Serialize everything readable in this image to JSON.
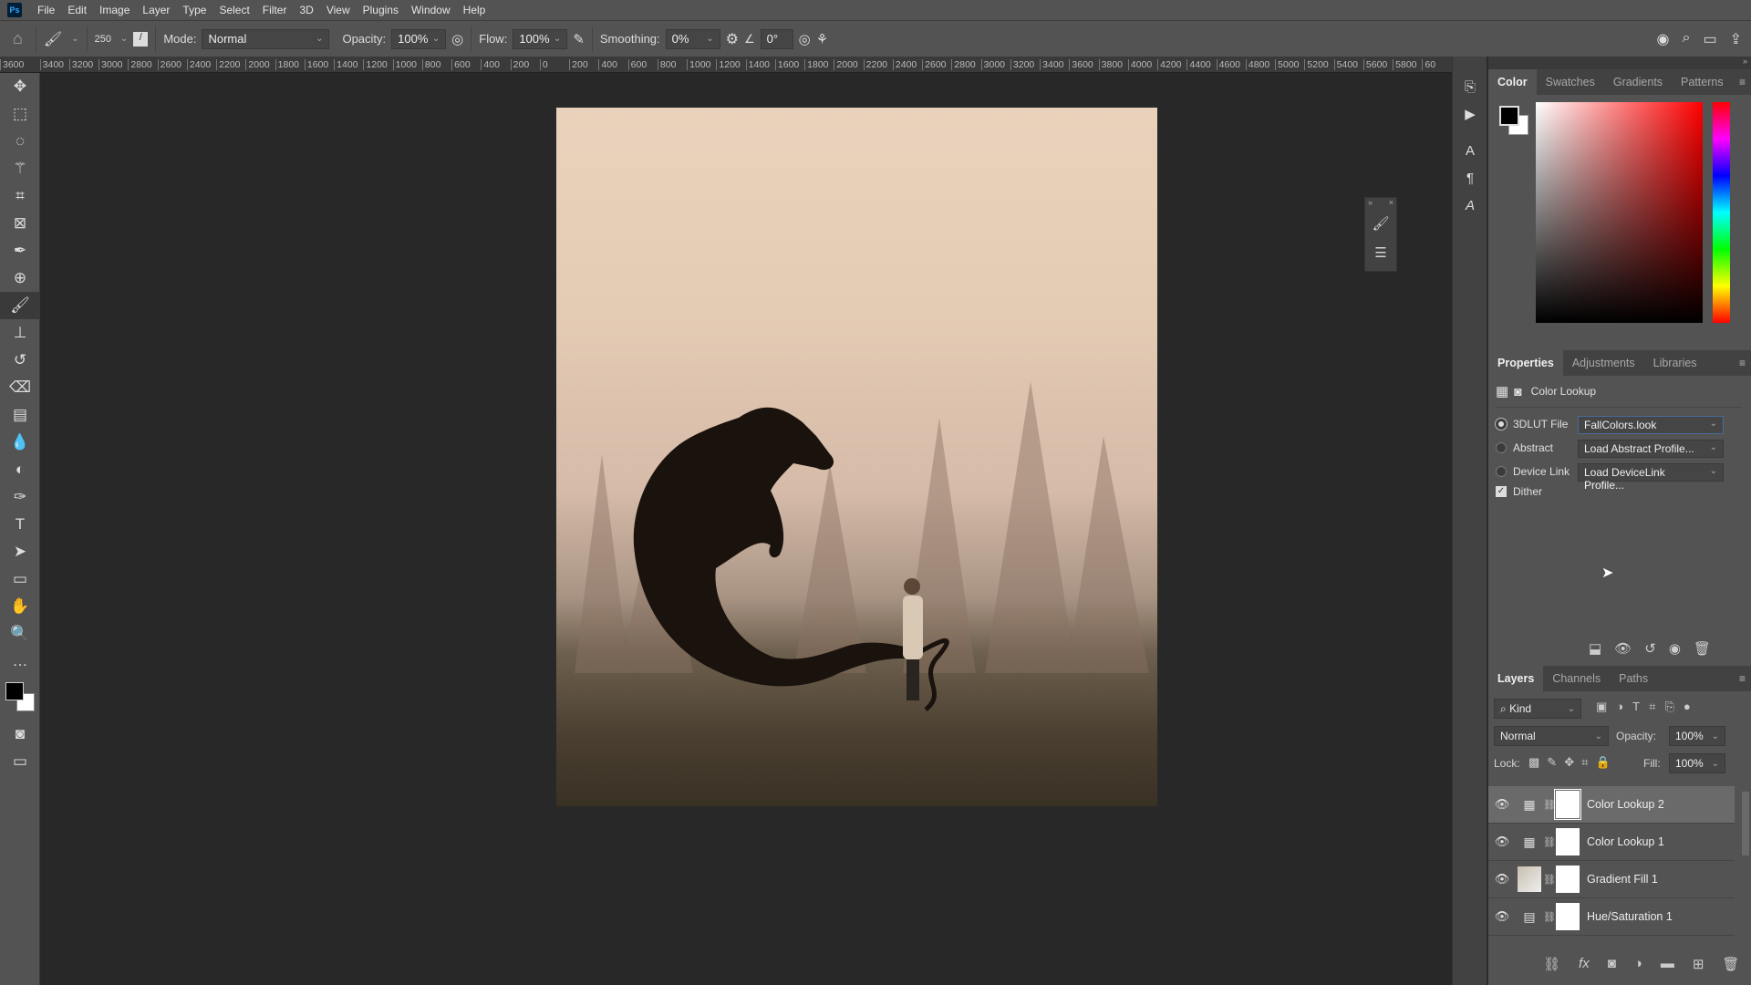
{
  "app": {
    "logo": "Ps",
    "menu": [
      "File",
      "Edit",
      "Image",
      "Layer",
      "Type",
      "Select",
      "Filter",
      "3D",
      "View",
      "Plugins",
      "Window",
      "Help"
    ]
  },
  "options": {
    "brush_size": "250",
    "mode_label": "Mode:",
    "mode": "Normal",
    "opacity_label": "Opacity:",
    "opacity": "100%",
    "flow_label": "Flow:",
    "flow": "100%",
    "smoothing_label": "Smoothing:",
    "smoothing": "0%",
    "angle": "0°"
  },
  "ruler": [
    "3600",
    "3400",
    "3200",
    "3000",
    "2800",
    "2600",
    "2400",
    "2200",
    "2000",
    "1800",
    "1600",
    "1400",
    "1200",
    "1000",
    "800",
    "600",
    "400",
    "200",
    "0",
    "200",
    "400",
    "600",
    "800",
    "1000",
    "1200",
    "1400",
    "1600",
    "1800",
    "2000",
    "2200",
    "2400",
    "2600",
    "2800",
    "3000",
    "3200",
    "3400",
    "3600",
    "3800",
    "4000",
    "4200",
    "4400",
    "4600",
    "4800",
    "5000",
    "5200",
    "5400",
    "5600",
    "5800",
    "60"
  ],
  "color_panel": {
    "tabs": [
      "Color",
      "Swatches",
      "Gradients",
      "Patterns"
    ],
    "active": "Color",
    "foreground": "#000000",
    "background": "#ffffff",
    "hue": "#ff0000"
  },
  "properties": {
    "tabs": [
      "Properties",
      "Adjustments",
      "Libraries"
    ],
    "title": "Color Lookup",
    "options": [
      {
        "label": "3DLUT File",
        "value": "FallColors.look",
        "selected": true
      },
      {
        "label": "Abstract",
        "value": "Load Abstract Profile...",
        "selected": false
      },
      {
        "label": "Device Link",
        "value": "Load DeviceLink Profile...",
        "selected": false
      }
    ],
    "dither_label": "Dither",
    "dither": true
  },
  "layers_panel": {
    "tabs": [
      "Layers",
      "Channels",
      "Paths"
    ],
    "filter": "Kind",
    "blend": "Normal",
    "opacity_label": "Opacity:",
    "opacity": "100%",
    "lock_label": "Lock:",
    "fill_label": "Fill:",
    "fill": "100%",
    "layers": [
      {
        "name": "Color Lookup 2",
        "selected": true
      },
      {
        "name": "Color Lookup 1",
        "selected": false
      },
      {
        "name": "Gradient Fill 1",
        "selected": false
      },
      {
        "name": "Hue/Saturation 1",
        "selected": false
      }
    ]
  }
}
